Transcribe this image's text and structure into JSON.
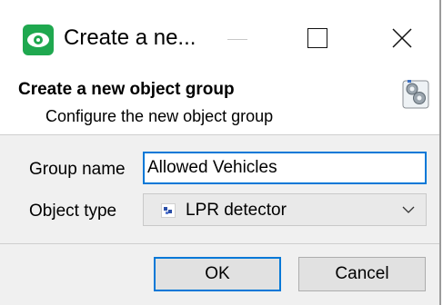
{
  "window": {
    "title": "Create a ne..."
  },
  "header": {
    "title": "Create a new object group",
    "subtitle": "Configure the new object group",
    "icon": "gear-icon"
  },
  "form": {
    "group_name_label": "Group name",
    "group_name_value": "Allowed Vehicles",
    "object_type_label": "Object type",
    "object_type_value": "LPR detector",
    "object_type_icon": "lpr-detector-icon"
  },
  "buttons": {
    "ok_label": "OK",
    "cancel_label": "Cancel"
  },
  "colors": {
    "accent": "#0078d7",
    "app_icon": "#1fa84f"
  }
}
